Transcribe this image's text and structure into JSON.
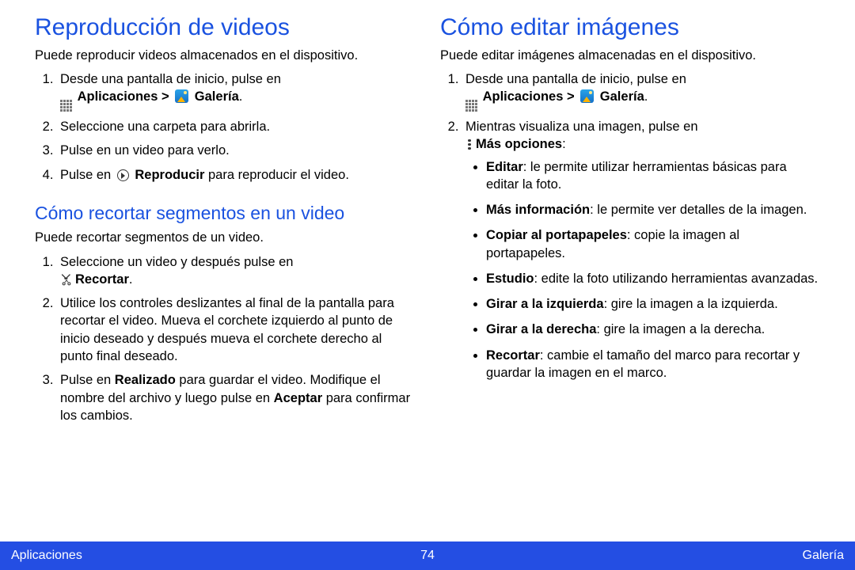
{
  "left": {
    "h1": "Reproducción de videos",
    "intro": "Puede reproducir videos almacenados en el dispositivo.",
    "steps": {
      "s1_pre": "Desde una pantalla de inicio, pulse en",
      "s1_apps": "Aplicaciones",
      "s1_sep": " > ",
      "s1_gallery": "Galería",
      "s2": "Seleccione una carpeta para abrirla.",
      "s3": "Pulse en un video para verlo.",
      "s4_pre": "Pulse en ",
      "s4_bold": "Reproducir",
      "s4_post": " para reproducir el video."
    },
    "h2": "Cómo recortar segmentos en un video",
    "trim_intro": "Puede recortar segmentos de un video.",
    "trim": {
      "t1_pre": "Seleccione un video y después pulse en",
      "t1_bold": "Recortar",
      "t2": "Utilice los controles deslizantes al final de la pantalla para recortar el video. Mueva el corchete izquierdo al punto de inicio deseado y después mueva el corchete derecho al punto final deseado.",
      "t3_pre": "Pulse en ",
      "t3_b1": "Realizado",
      "t3_mid": " para guardar el video. Modifique el nombre del archivo y luego pulse en ",
      "t3_b2": "Aceptar",
      "t3_post": " para confirmar los cambios."
    }
  },
  "right": {
    "h1": "Cómo editar imágenes",
    "intro": "Puede editar imágenes almacenadas en el dispositivo.",
    "steps": {
      "s1_pre": "Desde una pantalla de inicio, pulse en",
      "s1_apps": "Aplicaciones",
      "s1_sep": " > ",
      "s1_gallery": "Galería",
      "s2_pre": "Mientras visualiza una imagen, pulse en",
      "s2_bold": "Más opciones",
      "s2_post": ":"
    },
    "options": {
      "o1_b": "Editar",
      "o1_t": ": le permite utilizar herramientas básicas para editar la foto.",
      "o2_b": "Más información",
      "o2_t": ": le permite ver detalles de la imagen.",
      "o3_b": "Copiar al portapapeles",
      "o3_t": ": copie la imagen al portapapeles.",
      "o4_b": "Estudio",
      "o4_t": ": edite la foto utilizando herramientas avanzadas.",
      "o5_b": "Girar a la izquierda",
      "o5_t": ": gire la imagen a la izquierda.",
      "o6_b": "Girar a la derecha",
      "o6_t": ": gire la imagen a la derecha.",
      "o7_b": "Recortar",
      "o7_t": ": cambie el tamaño del marco para recortar y guardar la imagen en el marco."
    }
  },
  "footer": {
    "left": "Aplicaciones",
    "center": "74",
    "right": "Galería"
  }
}
